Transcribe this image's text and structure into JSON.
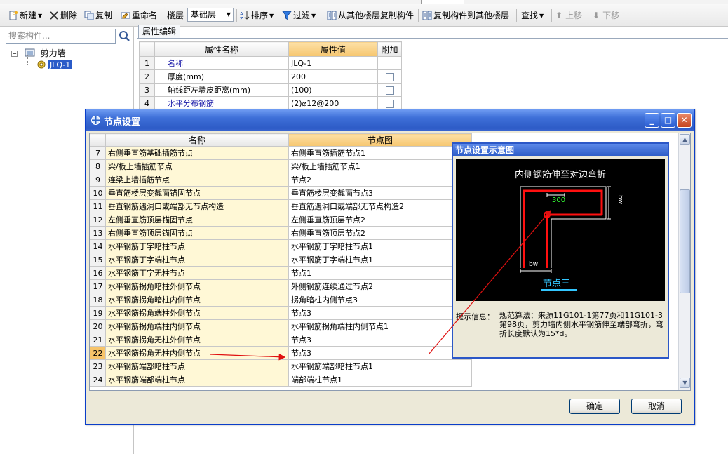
{
  "toolbar": {
    "new": "新建",
    "delete": "删除",
    "copy": "复制",
    "rename": "重命名",
    "floor_label": "楼层",
    "floor_value": "基础层",
    "sort": "排序",
    "filter": "过滤",
    "copy_from_floors": "从其他楼层复制构件",
    "copy_to_floors": "复制构件到其他楼层",
    "find": "查找",
    "move_up": "上移",
    "move_down": "下移"
  },
  "left": {
    "search_placeholder": "搜索构件...",
    "tree_root": "剪力墙",
    "tree_child": "JLQ-1"
  },
  "props": {
    "tab": "属性编辑",
    "headers": [
      "属性名称",
      "属性值",
      "附加"
    ],
    "rows": [
      {
        "num": "1",
        "name": "名称",
        "value": "JLQ-1"
      },
      {
        "num": "2",
        "name": "厚度(mm)",
        "value": "200"
      },
      {
        "num": "3",
        "name": "轴线距左墙皮距离(mm)",
        "value": "(100)"
      },
      {
        "num": "4",
        "name": "水平分布钢筋",
        "value": "(2)⌀12@200"
      }
    ]
  },
  "dialog": {
    "title": "节点设置",
    "headers": [
      "名称",
      "节点图"
    ],
    "rows": [
      {
        "num": "7",
        "name": "右侧垂直筋基础插筋节点",
        "value": "右侧垂直筋插筋节点1"
      },
      {
        "num": "8",
        "name": "梁/板上墙插筋节点",
        "value": "梁/板上墙插筋节点1"
      },
      {
        "num": "9",
        "name": "连梁上墙插筋节点",
        "value": "节点2"
      },
      {
        "num": "10",
        "name": "垂直筋楼层变截面锚固节点",
        "value": "垂直筋楼层变截面节点3"
      },
      {
        "num": "11",
        "name": "垂直钢筋遇洞口或端部无节点构造",
        "value": "垂直筋遇洞口或端部无节点构造2"
      },
      {
        "num": "12",
        "name": "左侧垂直筋顶层锚固节点",
        "value": "左侧垂直筋顶层节点2"
      },
      {
        "num": "13",
        "name": "右侧垂直筋顶层锚固节点",
        "value": "右侧垂直筋顶层节点2"
      },
      {
        "num": "14",
        "name": "水平钢筋丁字暗柱节点",
        "value": "水平钢筋丁字暗柱节点1"
      },
      {
        "num": "15",
        "name": "水平钢筋丁字端柱节点",
        "value": "水平钢筋丁字端柱节点1"
      },
      {
        "num": "16",
        "name": "水平钢筋丁字无柱节点",
        "value": "节点1"
      },
      {
        "num": "17",
        "name": "水平钢筋拐角暗柱外侧节点",
        "value": "外侧钢筋连续通过节点2"
      },
      {
        "num": "18",
        "name": "水平钢筋拐角暗柱内侧节点",
        "value": "拐角暗柱内侧节点3"
      },
      {
        "num": "19",
        "name": "水平钢筋拐角端柱外侧节点",
        "value": "节点3"
      },
      {
        "num": "20",
        "name": "水平钢筋拐角端柱内侧节点",
        "value": "水平钢筋拐角端柱内侧节点1"
      },
      {
        "num": "21",
        "name": "水平钢筋拐角无柱外侧节点",
        "value": "节点3"
      },
      {
        "num": "22",
        "name": "水平钢筋拐角无柱内侧节点",
        "value": "节点3"
      },
      {
        "num": "23",
        "name": "水平钢筋端部暗柱节点",
        "value": "水平钢筋端部暗柱节点1"
      },
      {
        "num": "24",
        "name": "水平钢筋端部端柱节点",
        "value": "端部端柱节点1"
      }
    ],
    "active_row_index": 15,
    "ok": "确定",
    "cancel": "取消"
  },
  "diagram": {
    "header": "节点设置示意图",
    "caption": "内侧钢筋伸至对边弯折",
    "dim_300": "300",
    "dim_bw_top": "bw",
    "dim_bw_bottom": "bw",
    "node": "节点三",
    "hint_label": "提示信息：",
    "hint_text": "规范算法：来源11G101-1第77页和11G101-3第98页，剪力墙内侧水平钢筋伸至端部弯折，弯折长度默认为15*d。"
  },
  "colors": {
    "accent": "#2a5bc8",
    "header_highlight": "#f6c66f",
    "name_cell": "#fff8d6",
    "annotation": "#e01010",
    "rebar": "#ff1010"
  }
}
